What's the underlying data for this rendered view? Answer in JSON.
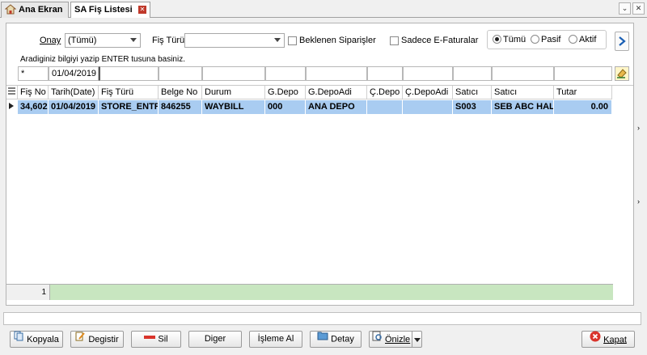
{
  "tabs": [
    {
      "label": "Ana Ekran"
    },
    {
      "label": "SA Fiş Listesi"
    }
  ],
  "filters": {
    "onay_label": "Onay",
    "onay_value": "(Tümü)",
    "fis_turu_label": "Fiş Türü",
    "fis_turu_value": "",
    "beklenen_label": "Beklenen Siparişler",
    "sadece_label": "Sadece E-Faturalar",
    "radio_tumu": "Tümü",
    "radio_pasif": "Pasif",
    "radio_aktif": "Aktif",
    "hint": "Aradiginiz bilgiyi yazip ENTER tusuna basiniz.",
    "search_values": [
      "*",
      "01/04/2019",
      "",
      "",
      "",
      "",
      "",
      "",
      "",
      "",
      "",
      ""
    ]
  },
  "grid": {
    "columns": [
      "Fiş No",
      "Tarih(Date)",
      "Fiş Türü",
      "Belge No",
      "Durum",
      "G.Depo",
      "G.DepoAdi",
      "Ç.Depo",
      "Ç.DepoAdi",
      "Satıcı",
      "Satıcı",
      "Tutar"
    ],
    "rows": [
      [
        "34,602",
        "01/04/2019",
        "STORE_ENTRY",
        "846255",
        "WAYBILL",
        "000",
        "ANA DEPO",
        "",
        "",
        "S003",
        "SEB ABC HAL MEYVE",
        "0.00"
      ]
    ],
    "footer_count": "1"
  },
  "buttons": {
    "kopyala": "Kopyala",
    "degistir": "Degistir",
    "sil": "Sil",
    "diger": "Diger",
    "isleme_al": "İşleme Al",
    "detay": "Detay",
    "onizle": "Önizle",
    "kapat": "Kapat"
  },
  "colors": {
    "row_selected": "#a9ccf1",
    "footer_green": "#c8e6c0",
    "close_red": "#d9342b"
  }
}
